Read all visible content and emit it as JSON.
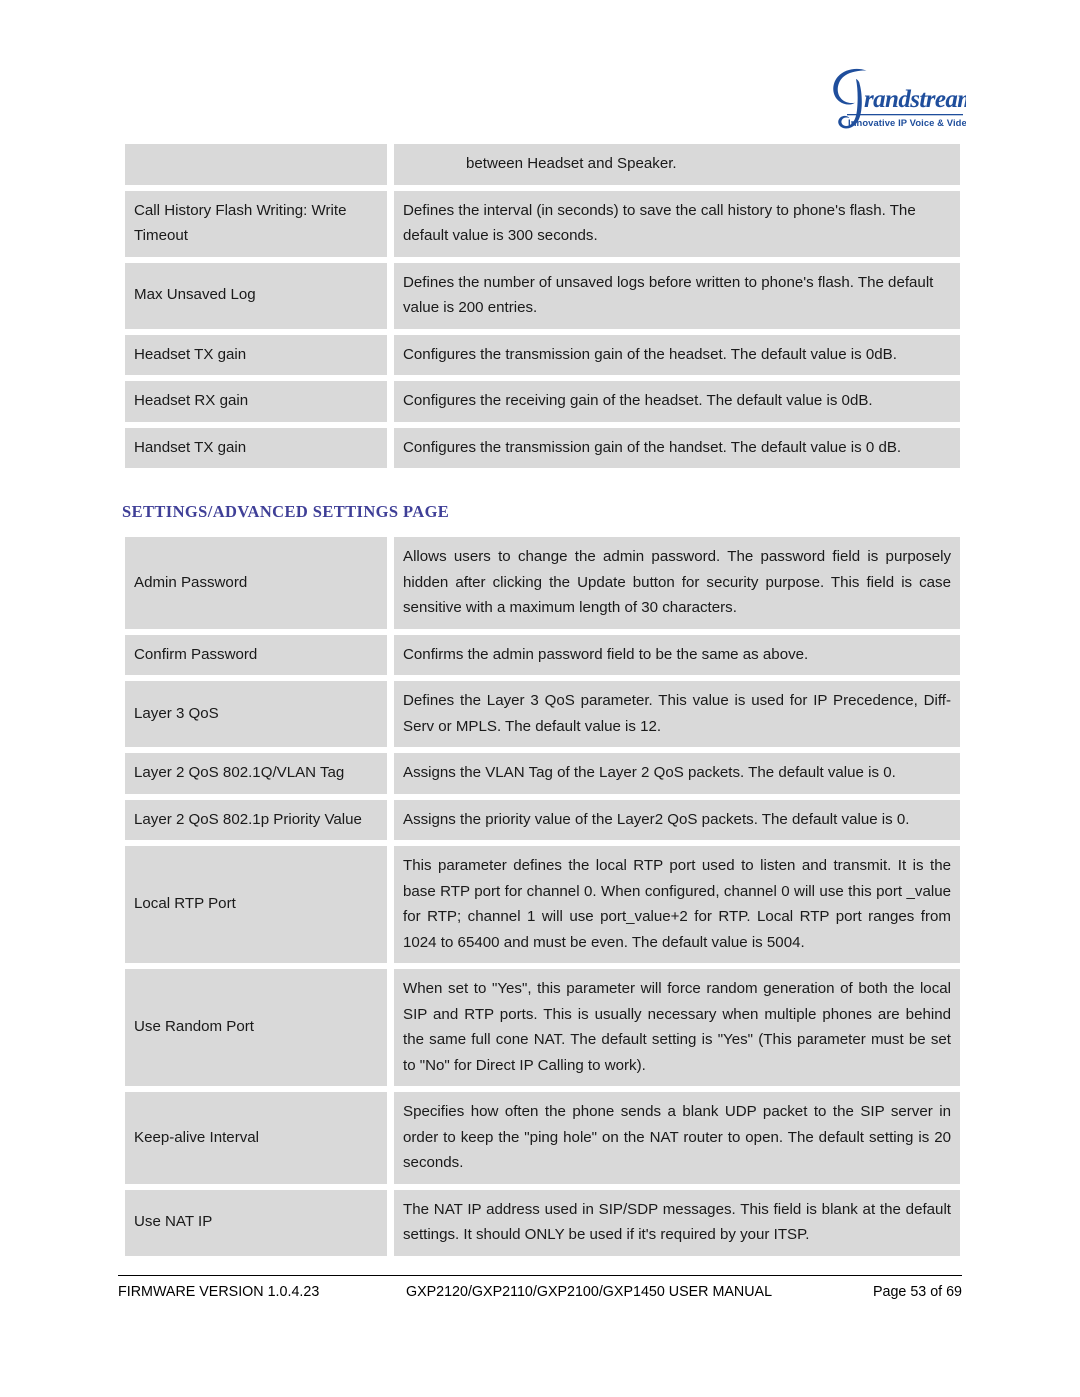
{
  "document": {
    "logo": {
      "name": "grandstream-logo",
      "wordmark": "randstream",
      "monogram": "G",
      "tagline": "Innovative IP Voice & Video",
      "color": "#1f4e9c"
    },
    "heading": {
      "text": "SETTINGS/ADVANCED SETTINGS PAGE",
      "color": "#3f3f97"
    },
    "footer": {
      "firmware": "FIRMWARE VERSION 1.0.4.23",
      "manual": "GXP2120/GXP2110/GXP2100/GXP1450 USER MANUAL",
      "page": "Page 53 of 69"
    },
    "table_top": {
      "name": "audio-settings-table",
      "rows": [
        {
          "label": "",
          "desc": "between Headset and Speaker.",
          "align": "indent"
        },
        {
          "label": "Call History Flash Writing: Write Timeout",
          "desc": "Defines the interval (in seconds) to save the call history to phone's flash. The default value is 300 seconds.",
          "align": "left"
        },
        {
          "label": "Max Unsaved Log",
          "desc": "Defines the number of unsaved logs before written to phone's flash. The default value is 200 entries.",
          "align": "left"
        },
        {
          "label": "Headset TX gain",
          "desc": "Configures the transmission gain of the headset. The default value is 0dB.",
          "align": "left"
        },
        {
          "label": "Headset RX gain",
          "desc": "Configures the receiving gain of the headset. The default value is 0dB.",
          "align": "left"
        },
        {
          "label": "Handset TX gain",
          "desc": "Configures the transmission gain of the handset. The default value is 0 dB.",
          "align": "left"
        }
      ]
    },
    "table_advanced": {
      "name": "advanced-settings-table",
      "rows": [
        {
          "label": "Admin Password",
          "desc": "Allows users to change the admin password. The password field is purposely hidden after clicking the Update button for security purpose. This field is case sensitive with a maximum length of 30 characters.",
          "align": "justify"
        },
        {
          "label": "Confirm Password",
          "desc": "Confirms the admin password field to be the same as above.",
          "align": "left"
        },
        {
          "label": "Layer 3 QoS",
          "desc": "Defines the Layer 3 QoS parameter. This value is used for IP Precedence, Diff-Serv or MPLS. The default value is 12.",
          "align": "justify"
        },
        {
          "label": "Layer 2 QoS 802.1Q/VLAN Tag",
          "desc": "Assigns the VLAN Tag of the Layer 2 QoS packets. The default value is 0.",
          "align": "left"
        },
        {
          "label": "Layer 2 QoS 802.1p Priority Value",
          "desc": "Assigns the priority value of the Layer2 QoS packets. The default value is 0.",
          "align": "left"
        },
        {
          "label": "Local RTP Port",
          "desc": "This parameter defines the local RTP port used to listen and transmit. It is the base RTP port for channel 0. When configured, channel 0 will use this port _value for RTP; channel 1 will use port_value+2 for RTP. Local RTP port ranges from 1024 to 65400 and must be even. The default value is 5004.",
          "align": "justify"
        },
        {
          "label": "Use Random Port",
          "desc": "When set to \"Yes\", this parameter will force random generation of both the local SIP and RTP ports. This is usually necessary when multiple phones are behind the same full cone NAT. The default setting is \"Yes\" (This parameter must be set to \"No\" for Direct IP Calling to work).",
          "align": "justify"
        },
        {
          "label": "Keep-alive Interval",
          "desc": "Specifies how often the phone sends a blank UDP packet to the SIP server in order to keep the \"ping hole\" on the NAT router to open. The default setting is 20 seconds.",
          "align": "justify"
        },
        {
          "label": "Use NAT IP",
          "desc": "The NAT IP address used in SIP/SDP messages. This field is blank at the default settings. It should ONLY be used if it's required by your ITSP.",
          "align": "justify"
        }
      ]
    }
  }
}
